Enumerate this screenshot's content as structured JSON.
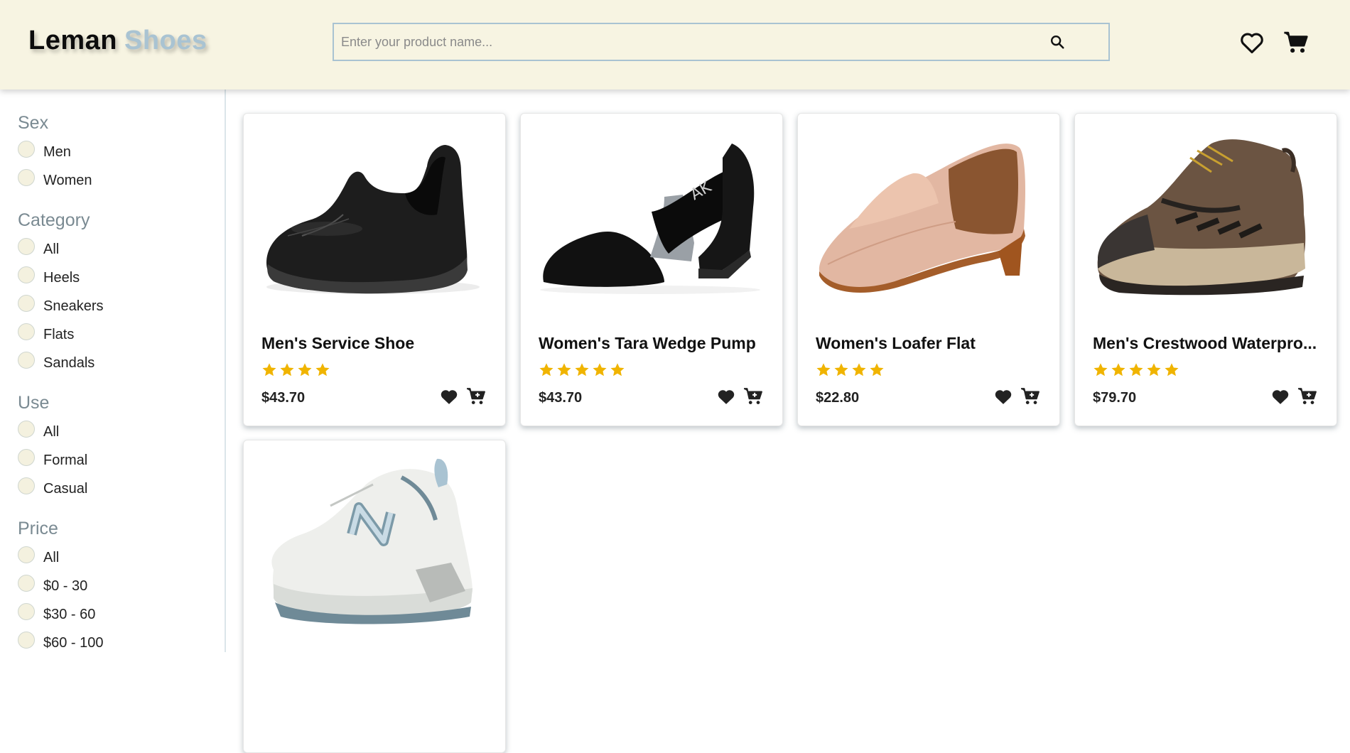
{
  "header": {
    "logo_part1": "Leman",
    "logo_part2": "Shoes",
    "search_placeholder": "Enter your product name...",
    "icons": [
      "search-icon",
      "heart-icon",
      "cart-icon"
    ]
  },
  "filters": {
    "sex": {
      "title": "Sex",
      "options": [
        "Men",
        "Women"
      ]
    },
    "category": {
      "title": "Category",
      "options": [
        "All",
        "Heels",
        "Sneakers",
        "Flats",
        "Sandals"
      ]
    },
    "use": {
      "title": "Use",
      "options": [
        "All",
        "Formal",
        "Casual"
      ]
    },
    "price": {
      "title": "Price",
      "options": [
        "All",
        "$0 - 30",
        "$30 - 60",
        "$60 - 100"
      ]
    }
  },
  "products": [
    {
      "title": "Men's Service Shoe",
      "rating": 4,
      "price": "$43.70",
      "image": "black-slip-on-service-shoe"
    },
    {
      "title": "Women's Tara Wedge Pump",
      "rating": 5,
      "price": "$43.70",
      "image": "black-wedge-pump"
    },
    {
      "title": "Women's Loafer Flat",
      "rating": 4,
      "price": "$22.80",
      "image": "pink-loafer-flat"
    },
    {
      "title": "Men's Crestwood Waterpro...",
      "rating": 5,
      "price": "$79.70",
      "image": "brown-hiking-shoe"
    },
    {
      "title": "",
      "rating": 0,
      "price": "",
      "image": "white-blue-sneaker"
    }
  ],
  "colors": {
    "header_bg": "#f7f4e2",
    "accent": "#a9c3d2",
    "star": "#f0b400"
  }
}
